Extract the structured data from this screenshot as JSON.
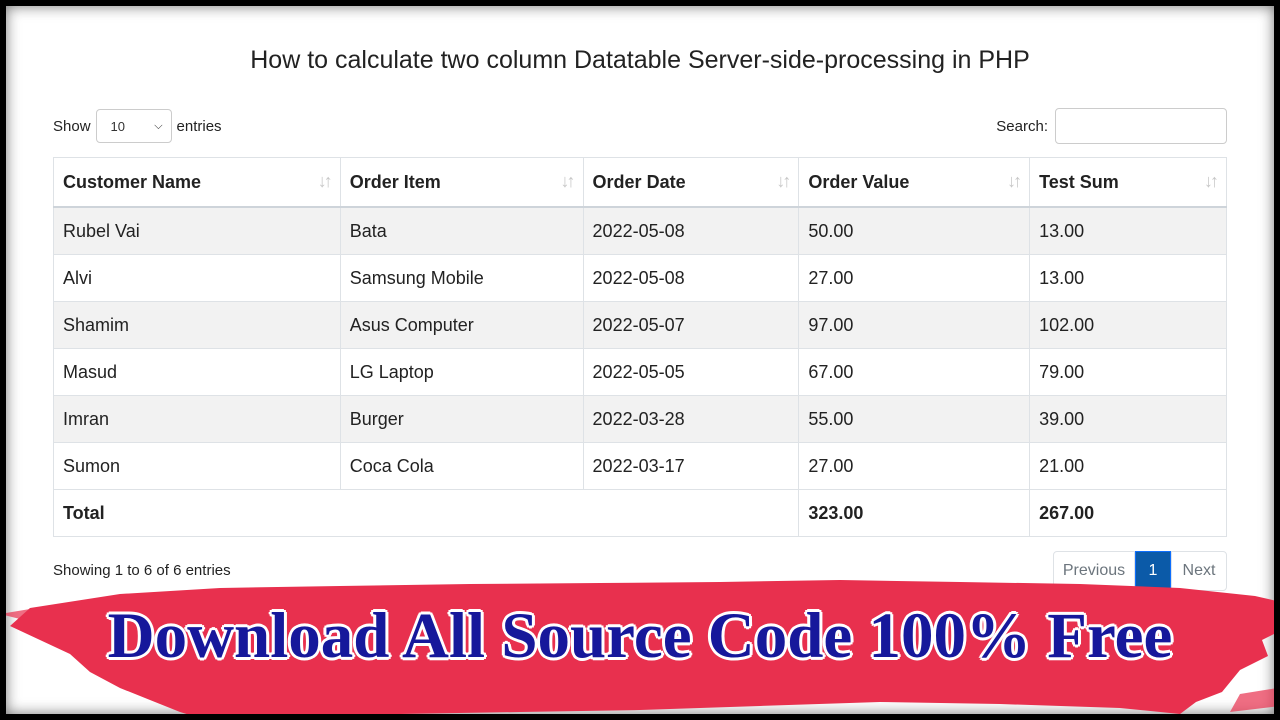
{
  "page": {
    "title": "How to calculate two column Datatable Server-side-processing in PHP"
  },
  "length_menu": {
    "show_label": "Show",
    "selected": "10",
    "entries_label": "entries"
  },
  "search": {
    "label": "Search:",
    "value": ""
  },
  "table": {
    "columns": [
      "Customer Name",
      "Order Item",
      "Order Date",
      "Order Value",
      "Test Sum"
    ],
    "rows": [
      [
        "Rubel Vai",
        "Bata",
        "2022-05-08",
        "50.00",
        "13.00"
      ],
      [
        "Alvi",
        "Samsung Mobile",
        "2022-05-08",
        "27.00",
        "13.00"
      ],
      [
        "Shamim",
        "Asus Computer",
        "2022-05-07",
        "97.00",
        "102.00"
      ],
      [
        "Masud",
        "LG Laptop",
        "2022-05-05",
        "67.00",
        "79.00"
      ],
      [
        "Imran",
        "Burger",
        "2022-03-28",
        "55.00",
        "39.00"
      ],
      [
        "Sumon",
        "Coca Cola",
        "2022-03-17",
        "27.00",
        "21.00"
      ]
    ],
    "footer": {
      "label": "Total",
      "order_value_total": "323.00",
      "test_sum_total": "267.00"
    }
  },
  "info": "Showing 1 to 6 of 6 entries",
  "pagination": {
    "previous": "Previous",
    "current": "1",
    "next": "Next"
  },
  "banner": {
    "text": "Download All Source Code 100% Free",
    "colors": {
      "brush": "#e8304e",
      "text": "#16189b"
    }
  },
  "icons": {
    "sort": "sort-both-icon",
    "dropdown": "chevron-down-icon"
  }
}
